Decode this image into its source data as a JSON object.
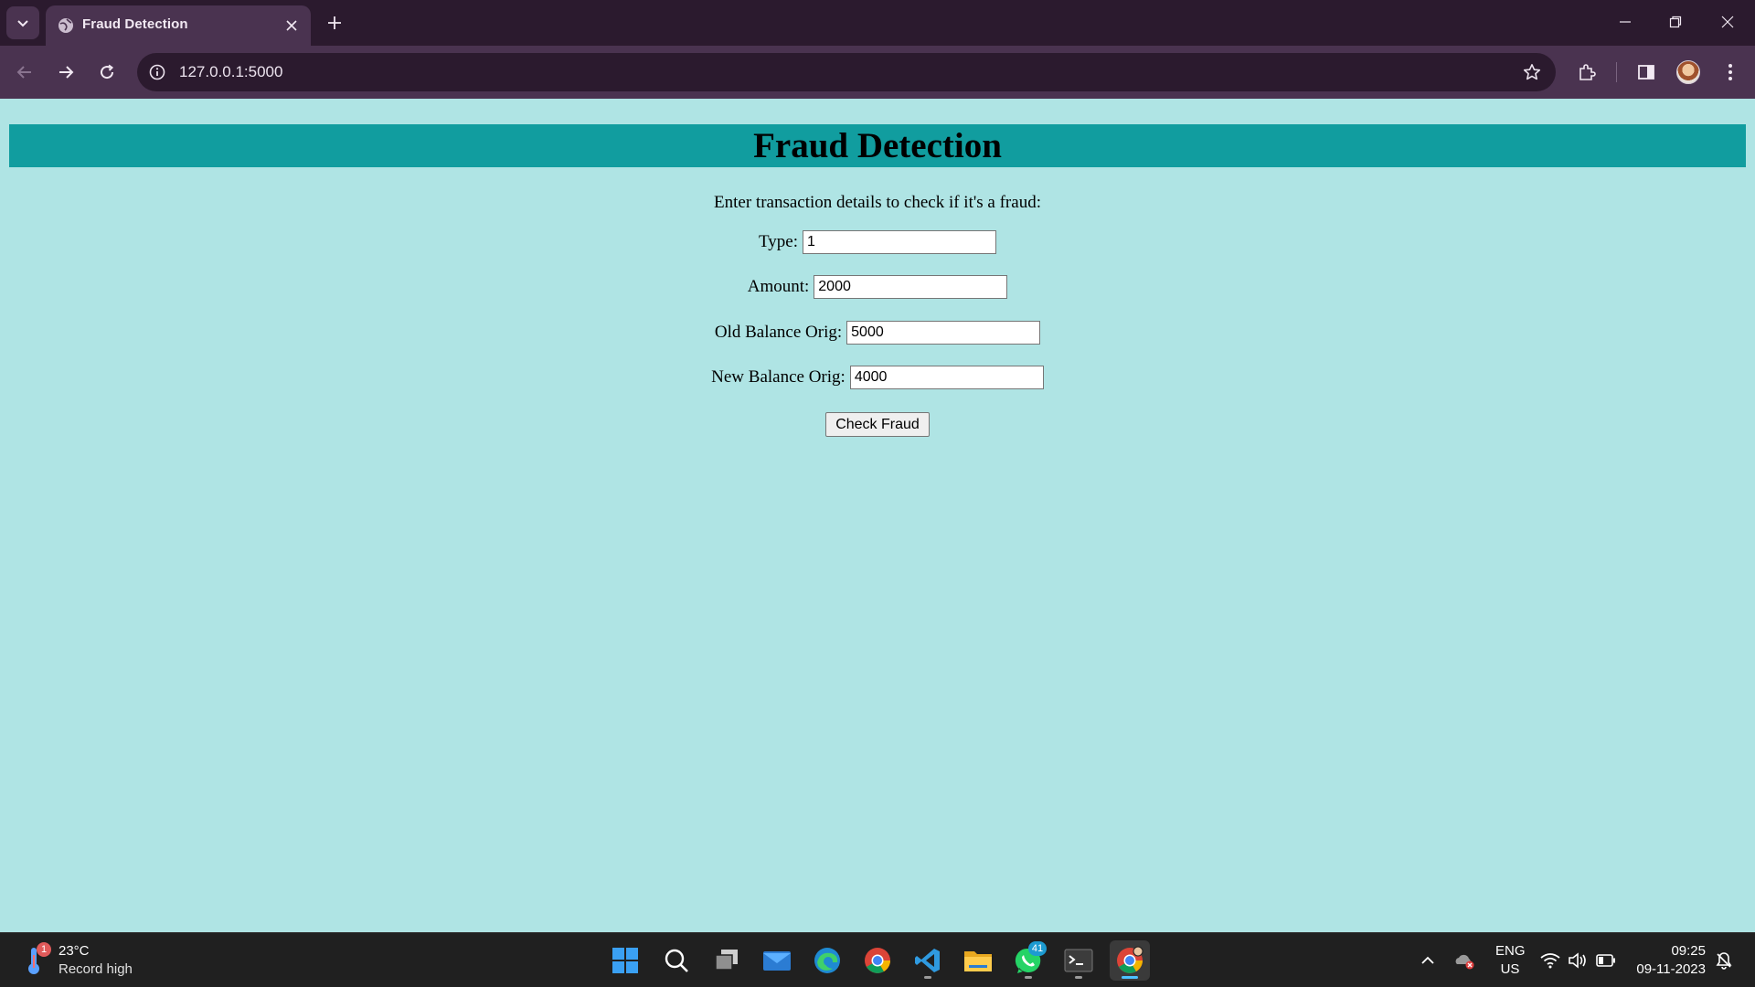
{
  "browser": {
    "tab_title": "Fraud Detection",
    "url": "127.0.0.1:5000"
  },
  "page": {
    "header_title": "Fraud Detection",
    "intro": "Enter transaction details to check if it's a fraud:",
    "fields": [
      {
        "label": "Type:",
        "value": "1"
      },
      {
        "label": "Amount:",
        "value": "2000"
      },
      {
        "label": "Old Balance Orig:",
        "value": "5000"
      },
      {
        "label": "New Balance Orig:",
        "value": "4000"
      }
    ],
    "submit_label": "Check Fraud"
  },
  "taskbar": {
    "weather_badge": "1",
    "temperature": "23°C",
    "weather_desc": "Record high",
    "whatsapp_badge": "41",
    "lang_primary": "ENG",
    "lang_secondary": "US",
    "time": "09:25",
    "date": "09-11-2023"
  },
  "colors": {
    "page_background": "#afe4e4",
    "header_background": "#119d9f",
    "browser_frame": "#2b1a2e",
    "browser_toolbar": "#4a3350",
    "taskbar": "#202020"
  },
  "icons": [
    "tab-list-icon",
    "globe-icon",
    "close-icon",
    "plus-icon",
    "minimize-icon",
    "restore-icon",
    "back-icon",
    "forward-icon",
    "reload-icon",
    "site-info-icon",
    "star-icon",
    "extensions-icon",
    "side-panel-icon",
    "menu-icon",
    "thermometer-icon",
    "windows-start-icon",
    "search-icon",
    "task-view-icon",
    "mail-icon",
    "edge-icon",
    "chrome-icon",
    "vscode-icon",
    "file-explorer-icon",
    "whatsapp-icon",
    "terminal-icon",
    "chevron-up-icon",
    "onedrive-icon",
    "wifi-icon",
    "speaker-icon",
    "battery-icon",
    "notification-icon"
  ]
}
